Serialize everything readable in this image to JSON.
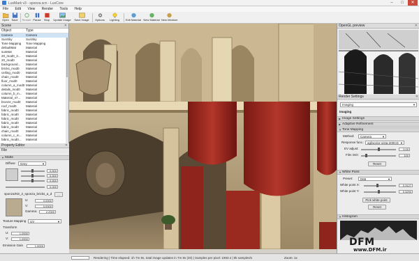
{
  "window": {
    "title": "LuxMark v3 - sponza.scn - LuxCore",
    "min": "–",
    "max": "□",
    "close": "✕"
  },
  "menu": [
    "File",
    "Edit",
    "View",
    "Render",
    "Tools",
    "Help"
  ],
  "toolbar": [
    {
      "label": "Open",
      "icon": "folder-open-icon"
    },
    {
      "label": "Save",
      "icon": "save-icon"
    },
    {
      "label": "Restart",
      "icon": "restart-icon"
    },
    {
      "label": "Pause",
      "icon": "pause-icon"
    },
    {
      "label": "Stop",
      "icon": "stop-icon"
    },
    {
      "label": "Update Image",
      "icon": "update-image-icon"
    },
    {
      "label": "Save Image",
      "icon": "save-image-icon"
    },
    {
      "label": "Options",
      "icon": "options-icon"
    },
    {
      "label": "Lighting",
      "icon": "lighting-icon"
    },
    {
      "label": "Edit Material",
      "icon": "edit-material-icon"
    },
    {
      "label": "New Material",
      "icon": "new-material-icon"
    },
    {
      "label": "New Medium",
      "icon": "new-medium-icon"
    }
  ],
  "scene": {
    "title": "Scene",
    "columns": [
      "Object",
      "Type"
    ],
    "rows": [
      [
        "Camera",
        "Camera"
      ],
      [
        "SunSky",
        "SunSky"
      ],
      [
        "Tone Mapping",
        "Tone Mapping"
      ],
      [
        "defaultMat",
        "Material"
      ],
      [
        "sunMat",
        "Material"
      ],
      [
        "20_mod0_3...",
        "Material"
      ],
      [
        "20_mod0",
        "Material"
      ],
      [
        "background...",
        "Material"
      ],
      [
        "bricks_mod0",
        "Material"
      ],
      [
        "ceiling_mod0",
        "Material"
      ],
      [
        "chain_mod0",
        "Material"
      ],
      [
        "floor_mod0",
        "Material"
      ],
      [
        "column_a_mod0",
        "Material"
      ],
      [
        "details_mod0",
        "Material"
      ],
      [
        "column_b_m...",
        "Material"
      ],
      [
        "Material_47...",
        "Material"
      ],
      [
        "bronze_mod0",
        "Material"
      ],
      [
        "roof_mod0",
        "Material"
      ],
      [
        "fabric_mod0",
        "Material"
      ],
      [
        "fabric_mod0",
        "Material"
      ],
      [
        "fabric_mod0",
        "Material"
      ],
      [
        "fabric_mod0",
        "Material"
      ],
      [
        "fabric_mod0",
        "Material"
      ],
      [
        "chain_mod0",
        "Material"
      ],
      [
        "column_c_m...",
        "Material"
      ],
      [
        "fabric_mod0...",
        "Material"
      ]
    ]
  },
  "properties": {
    "title": "Property Editor",
    "file": "File",
    "material_label": "Matte",
    "kd_label": "Diffuse",
    "kd_value": "Grey",
    "r_value": "0.500",
    "g_value": "0.500",
    "b_value": "0.500",
    "texture_name": "sponza/KD_2_sponza_bricks_a_diff.jpg",
    "texture_btn": "...",
    "u_label": "U:",
    "u_value": "0.0000",
    "v_label": "V:",
    "v_value": "0.0000",
    "gamma_label": "Gamma:",
    "gamma_value": "2.2000",
    "mapping_label": "Texture Mapping",
    "mapping_value": "UV",
    "transform_label": "Transform",
    "uscale_label": "U:",
    "uscale_value": "1.0000",
    "vscale_label": "V:",
    "vscale_value": "1.0000",
    "emission_label": "Emission Gain",
    "emission_value": "1.0000",
    "row_values": [
      "0.000",
      "0.000",
      "0.000",
      "0.000"
    ]
  },
  "right": {
    "preview_title": "OpenGL preview",
    "render_settings_title": "Render Settings",
    "imaging_dd": "Imaging",
    "imaging_header": "Imaging",
    "sections": [
      "Image Settings",
      "Adaptive Refinement",
      "Tone Mapping"
    ],
    "method_label": "Method:",
    "method_value": "Camera",
    "response_label": "Response func.:",
    "response_value": "agfacolor-vista-200CD",
    "ev_label": "EV adjust:",
    "ev_value": "0.00",
    "film_iso_label": "Film ISO:",
    "film_iso_value": "100",
    "reset_btn": "Reset",
    "white_point_title": "White Point",
    "preset_label": "Preset:",
    "preset_value": "D65",
    "wp_x_label": "White point X:",
    "wp_x_value": "0.3127",
    "wp_y_label": "White point Y:",
    "wp_y_value": "0.3290",
    "pick_btn": "Pick white point",
    "reset2_btn": "Reset",
    "histogram_title": "Histogram"
  },
  "status": {
    "text": "Rendering | Time elapsed: 1h 7m 9s, total image updates in 7m 8s (20) | Samples per pixel: 1983.4 | 8k samples/s",
    "zoom": "Zoom: 1x"
  },
  "watermark": {
    "main": "DFM",
    "url": "www.DFM.ir"
  }
}
